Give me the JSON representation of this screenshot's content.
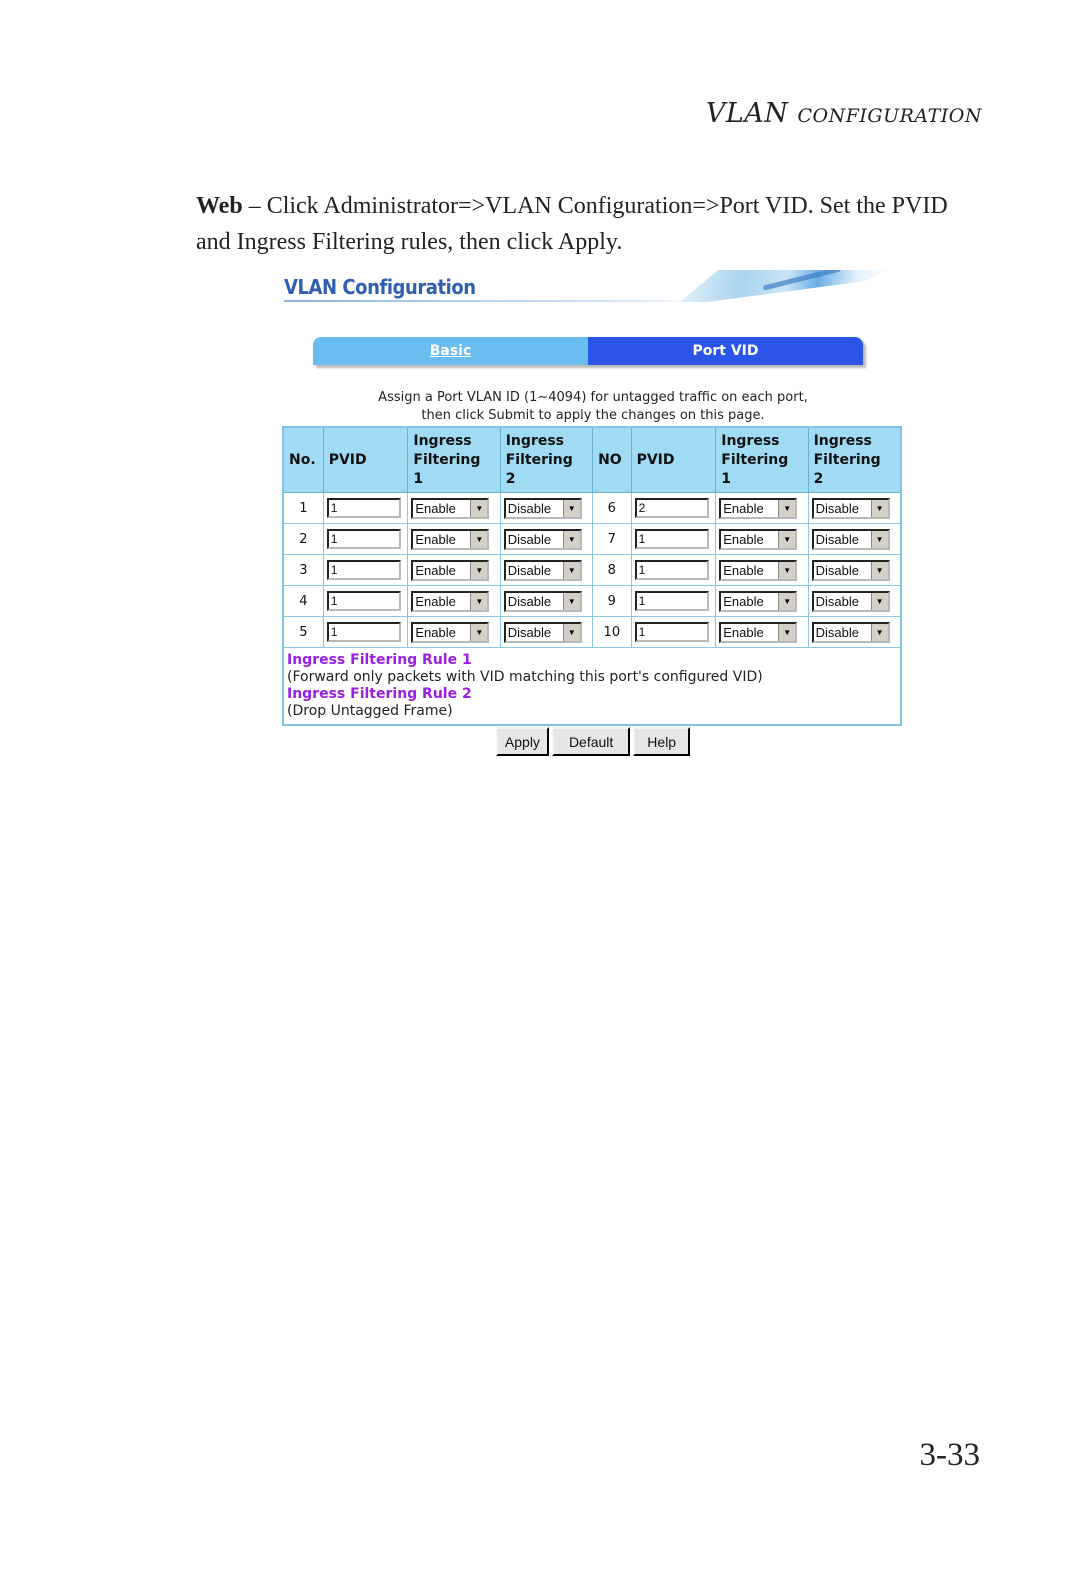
{
  "running_head": {
    "first": "VLAN",
    "rest": "Configuration"
  },
  "instructions": {
    "lead": "Web",
    "text": " – Click Administrator=>VLAN Configuration=>Port VID. Set the PVID and Ingress Filtering rules, then click Apply."
  },
  "screenshot": {
    "banner_title": "VLAN Configuration",
    "tabs": [
      {
        "label": "Basic",
        "active": false
      },
      {
        "label": "Port VID",
        "active": true
      }
    ],
    "assign_line1": "Assign a Port VLAN ID (1~4094) for untagged traffic on each port,",
    "assign_line2": "then click Submit to apply the changes on this page.",
    "table": {
      "headers_left": [
        "No.",
        "PVID",
        "Ingress Filtering 1",
        "Ingress Filtering 2"
      ],
      "headers_right": [
        "NO",
        "PVID",
        "Ingress Filtering 1",
        "Ingress Filtering 2"
      ],
      "rows": [
        {
          "left": {
            "no": "1",
            "pvid": "1",
            "if1": "Enable",
            "if2": "Disable"
          },
          "right": {
            "no": "6",
            "pvid": "2",
            "if1": "Enable",
            "if2": "Disable"
          }
        },
        {
          "left": {
            "no": "2",
            "pvid": "1",
            "if1": "Enable",
            "if2": "Disable"
          },
          "right": {
            "no": "7",
            "pvid": "1",
            "if1": "Enable",
            "if2": "Disable"
          }
        },
        {
          "left": {
            "no": "3",
            "pvid": "1",
            "if1": "Enable",
            "if2": "Disable"
          },
          "right": {
            "no": "8",
            "pvid": "1",
            "if1": "Enable",
            "if2": "Disable"
          }
        },
        {
          "left": {
            "no": "4",
            "pvid": "1",
            "if1": "Enable",
            "if2": "Disable"
          },
          "right": {
            "no": "9",
            "pvid": "1",
            "if1": "Enable",
            "if2": "Disable"
          }
        },
        {
          "left": {
            "no": "5",
            "pvid": "1",
            "if1": "Enable",
            "if2": "Disable"
          },
          "right": {
            "no": "10",
            "pvid": "1",
            "if1": "Enable",
            "if2": "Disable"
          }
        }
      ],
      "dropdown_icon": "triangle-down-icon"
    },
    "rules": [
      {
        "title": "Ingress Filtering Rule 1",
        "desc": "(Forward only packets with VID matching this port's configured VID)"
      },
      {
        "title": "Ingress Filtering Rule 2",
        "desc": "(Drop Untagged Frame)"
      }
    ],
    "buttons": {
      "apply": "Apply",
      "default": "Default",
      "help": "Help"
    }
  },
  "page_number": "3-33"
}
